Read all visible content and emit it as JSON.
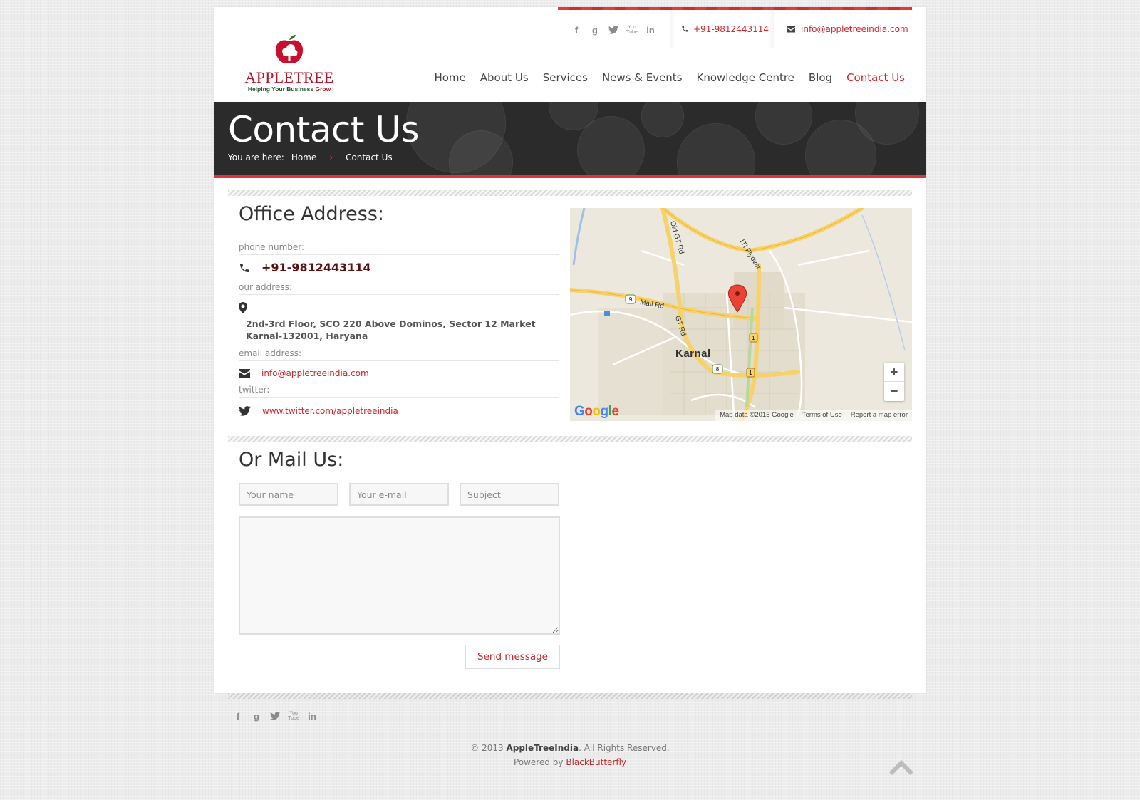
{
  "brand": {
    "logo_name": "AppleTree",
    "logo_word_1": "APPLE",
    "logo_word_2": "TREE",
    "tagline": "Helping Your Business",
    "tagline_accent": "Grow"
  },
  "topbar": {
    "phone": "+91-9812443114",
    "email": "info@appletreeindia.com",
    "social": [
      "facebook",
      "google-plus",
      "twitter",
      "youtube",
      "linkedin"
    ]
  },
  "nav": {
    "items": [
      {
        "label": "Home",
        "active": false
      },
      {
        "label": "About Us",
        "active": false
      },
      {
        "label": "Services",
        "active": false
      },
      {
        "label": "News & Events",
        "active": false
      },
      {
        "label": "Knowledge Centre",
        "active": false
      },
      {
        "label": "Blog",
        "active": false
      },
      {
        "label": "Contact Us",
        "active": true
      }
    ]
  },
  "banner": {
    "title": "Contact Us",
    "breadcrumb_prefix": "You are here:",
    "breadcrumb_home": "Home",
    "breadcrumb_sep": "›",
    "breadcrumb_current": "Contact Us"
  },
  "office": {
    "title": "Office Address:",
    "phone_label": "phone number:",
    "phone": "+91-9812443114",
    "address_label": "our address:",
    "address": "2nd-3rd Floor, SCO 220 Above Dominos, Sector 12 Market Karnal-132001, Haryana",
    "email_label": "email address:",
    "email": "info@appletreeindia.com",
    "twitter_label": "twitter:",
    "twitter": "www.twitter.com/appletreeindia"
  },
  "map": {
    "city": "Karnal",
    "roads": [
      "Old GT Rd",
      "ITI Flyover",
      "Mall Rd",
      "GT Rd"
    ],
    "shields": [
      "9",
      "8",
      "1",
      "1"
    ],
    "zoom_in": "+",
    "zoom_out": "−",
    "google": "Google",
    "attribution": "Map data ©2015 Google",
    "terms": "Terms of Use",
    "report": "Report a map error"
  },
  "mail": {
    "title": "Or Mail Us:",
    "name_placeholder": "Your name",
    "email_placeholder": "Your e-mail",
    "subject_placeholder": "Subject",
    "message_value": "",
    "send_label": "Send message"
  },
  "footer": {
    "copyright_prefix": "© 2013",
    "copyright_brand": "AppleTreeIndia",
    "copyright_suffix": ". All Rights Reserved.",
    "powered_prefix": "Powered by",
    "powered_brand": "BlackButterfly"
  },
  "colors": {
    "accent": "#d0242a",
    "banner_bg": "#2b2b2b",
    "banner_border": "#e0353b",
    "logo_green": "#1f5a2a"
  }
}
